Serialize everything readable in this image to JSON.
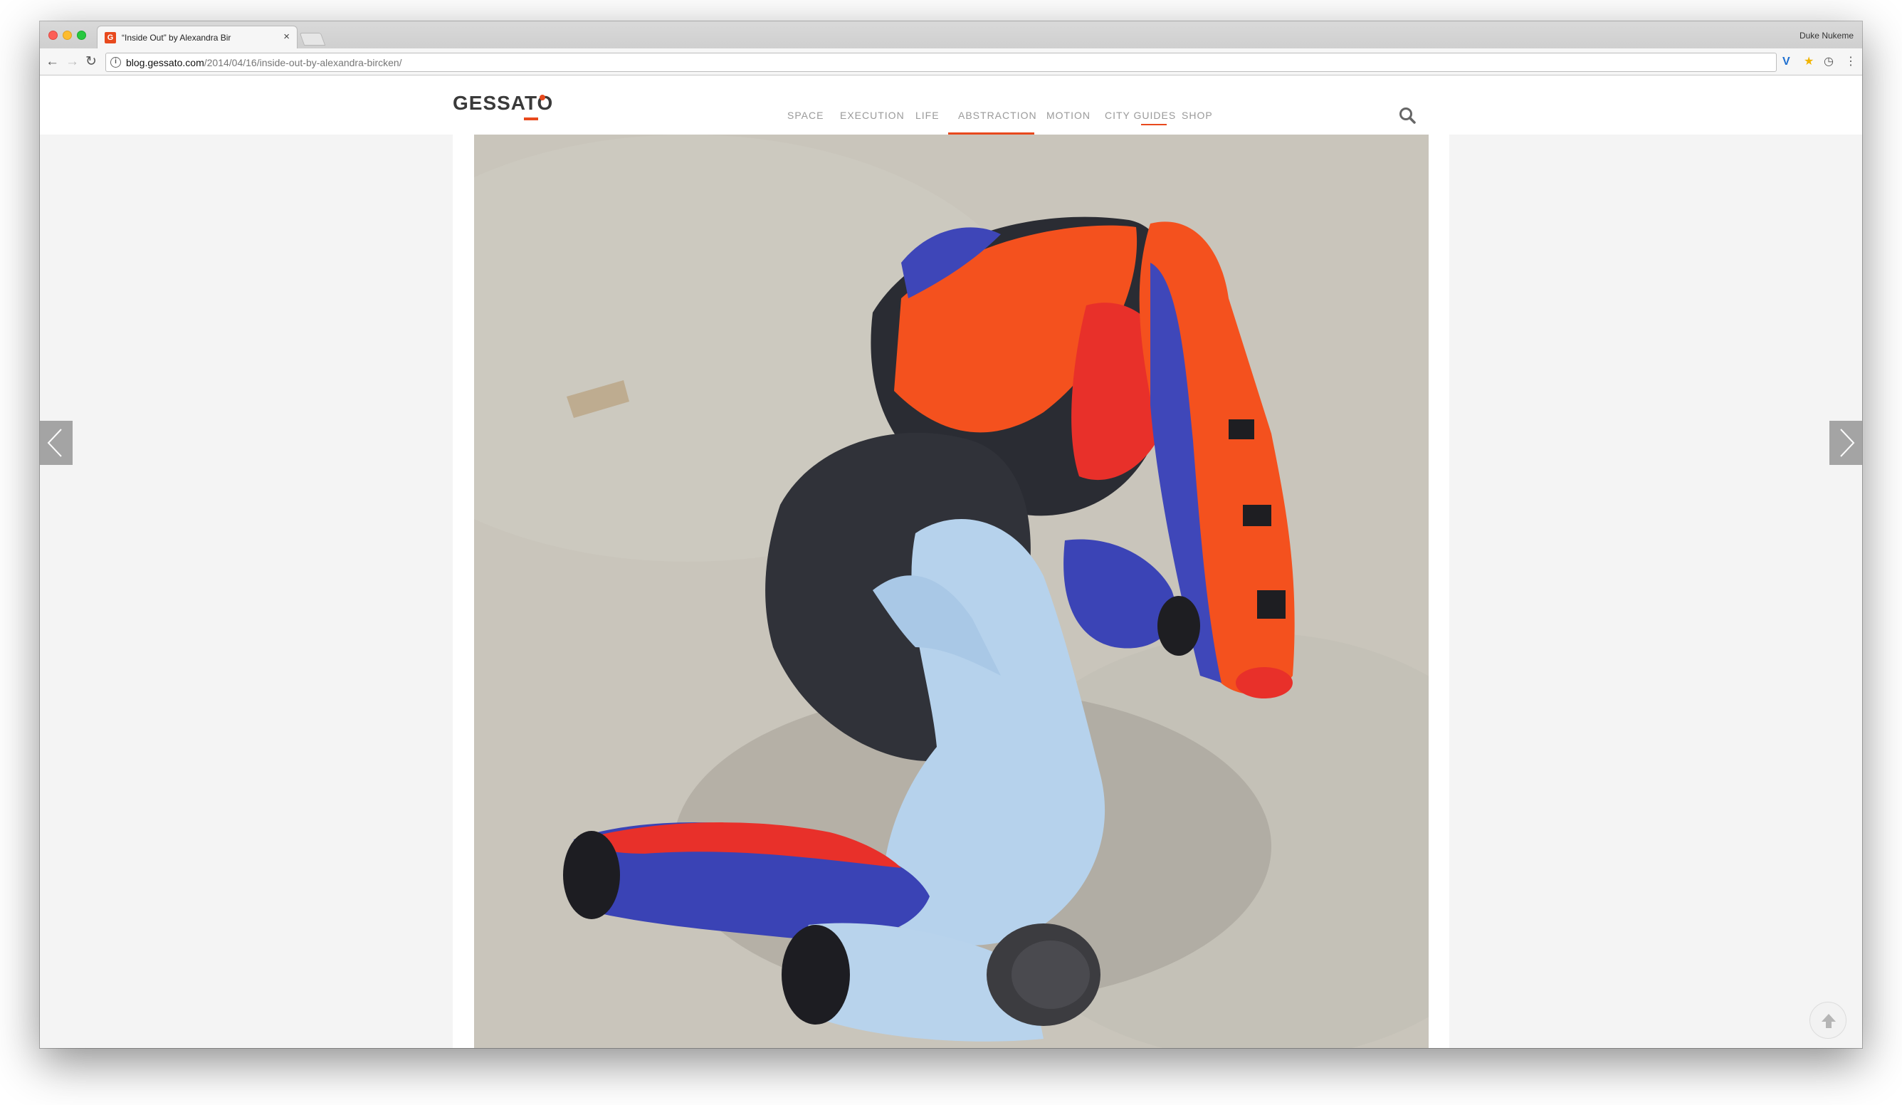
{
  "browser": {
    "tab_title": "“Inside Out” by Alexandra Bir",
    "tab_close": "×",
    "profile_name": "Duke Nukeme",
    "url_host": "blog.gessato.com",
    "url_path": "/2014/04/16/inside-out-by-alexandra-bircken/",
    "back_icon": "←",
    "forward_icon": "→",
    "reload_icon": "↻",
    "info_icon": "i",
    "ext_v_icon": "V",
    "star_icon": "★",
    "ext_clock_icon": "◷",
    "menu_icon": "⋮"
  },
  "site": {
    "logo": "GESSATO",
    "nav": [
      {
        "label": "SPACE"
      },
      {
        "label": "EXECUTION"
      },
      {
        "label": "LIFE"
      },
      {
        "label": "ABSTRACTION"
      },
      {
        "label": "MOTION"
      },
      {
        "label": "CITY GUIDES"
      },
      {
        "label": "SHOP"
      }
    ],
    "active_nav": "ABSTRACTION"
  },
  "colors": {
    "accent": "#e8491d",
    "nav_text": "#9a9a9a"
  },
  "image": {
    "alt": "Motorcycle leather suit sculpture on concrete floor"
  }
}
